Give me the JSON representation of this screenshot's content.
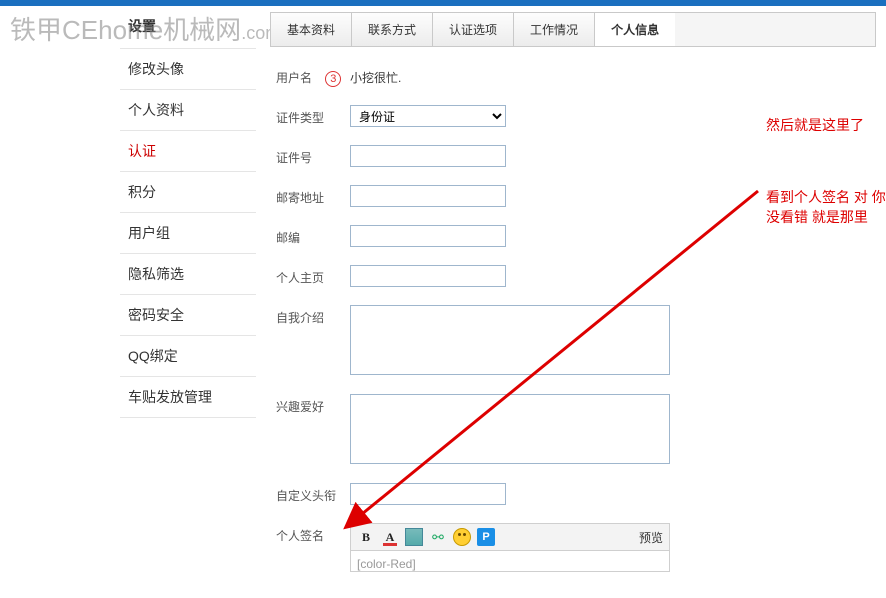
{
  "watermark": {
    "prefix_cn": "铁甲",
    "brand": "CEhome",
    "suffix_cn": "机械网",
    "dom": ".com"
  },
  "sidebar": {
    "title": "设置",
    "items": [
      {
        "label": "修改头像"
      },
      {
        "label": "个人资料"
      },
      {
        "label": "认证",
        "active": true
      },
      {
        "label": "积分"
      },
      {
        "label": "用户组"
      },
      {
        "label": "隐私筛选"
      },
      {
        "label": "密码安全"
      },
      {
        "label": "QQ绑定"
      },
      {
        "label": "车贴发放管理"
      }
    ]
  },
  "tabs": [
    {
      "label": "基本资料"
    },
    {
      "label": "联系方式"
    },
    {
      "label": "认证选项"
    },
    {
      "label": "工作情况"
    },
    {
      "label": "个人信息",
      "active": true
    }
  ],
  "form": {
    "username": {
      "label": "用户名",
      "badge": "3",
      "value": "小挖很忙."
    },
    "id_type": {
      "label": "证件类型",
      "selected": "身份证"
    },
    "id_no": {
      "label": "证件号",
      "value": ""
    },
    "address": {
      "label": "邮寄地址",
      "value": ""
    },
    "zipcode": {
      "label": "邮编",
      "value": ""
    },
    "homepage": {
      "label": "个人主页",
      "value": ""
    },
    "intro": {
      "label": "自我介绍",
      "value": ""
    },
    "hobby": {
      "label": "兴趣爱好",
      "value": ""
    },
    "title": {
      "label": "自定义头衔",
      "value": ""
    },
    "signature": {
      "label": "个人签名",
      "raw_hint": "[color-Red]"
    }
  },
  "editor": {
    "preview": "预览"
  },
  "annotations": {
    "a": "然后就是这里了",
    "b": "看到个人签名 对 你没看错 就是那里"
  }
}
